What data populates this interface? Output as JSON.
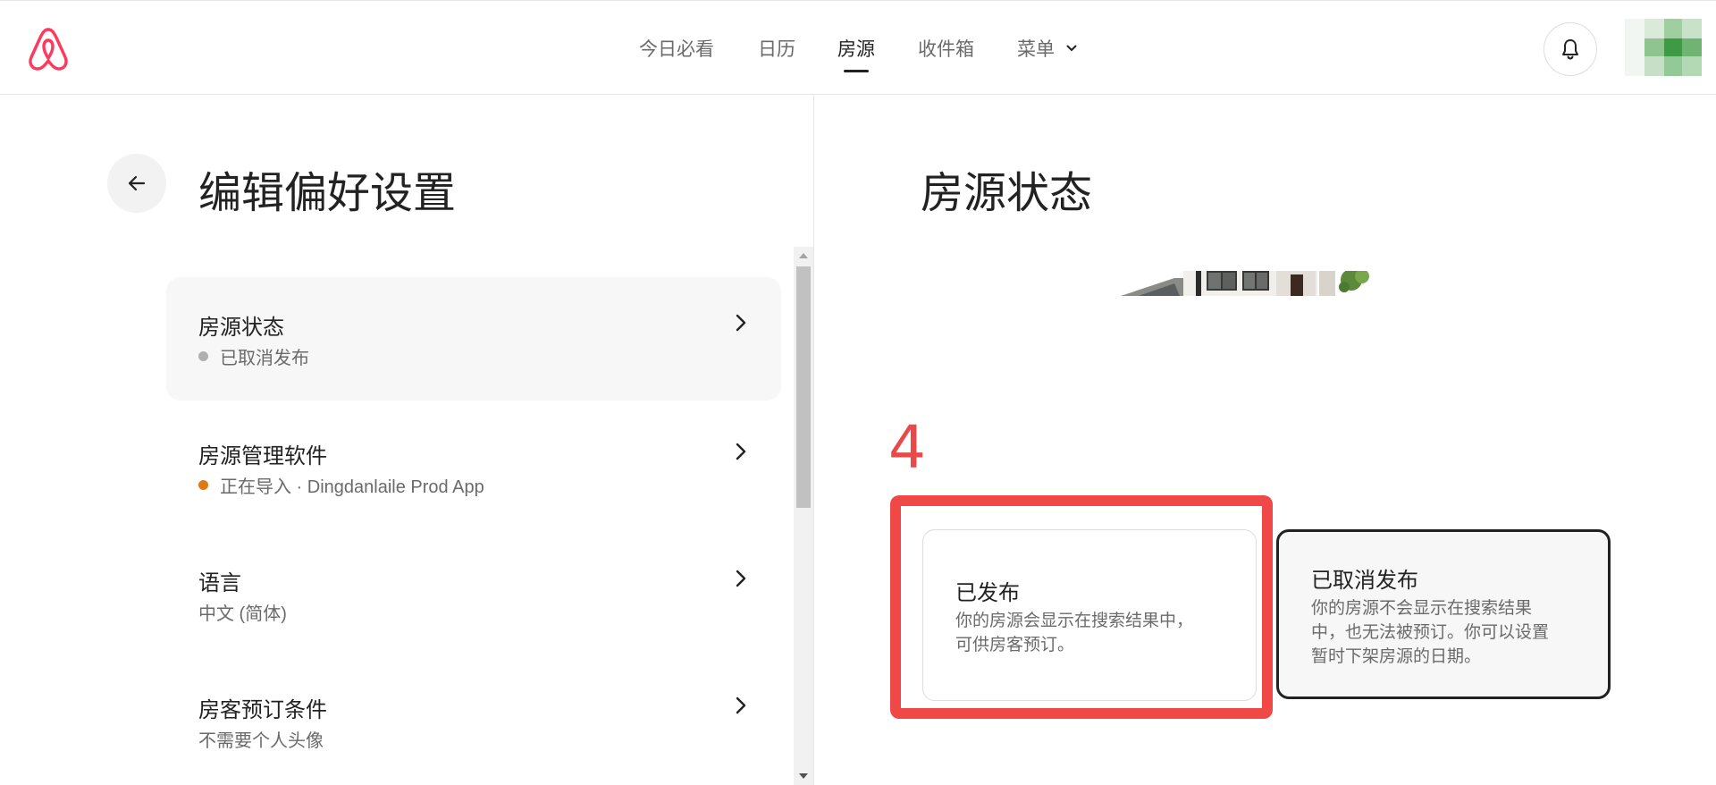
{
  "header": {
    "nav": [
      {
        "label": "今日必看"
      },
      {
        "label": "日历"
      },
      {
        "label": "房源"
      },
      {
        "label": "收件箱"
      },
      {
        "label": "菜单"
      }
    ],
    "active_nav": "房源",
    "logo_icon": "airbnb-logo-icon",
    "bell_icon": "bell-icon",
    "brand_color": "#ff385c"
  },
  "left": {
    "title": "编辑偏好设置",
    "items": [
      {
        "title": "房源状态",
        "subtitle": "已取消发布",
        "dot_color": "#b0b0b0"
      },
      {
        "title": "房源管理软件",
        "subtitle": "正在导入 · Dingdanlaile Prod App",
        "dot_color": "#e07912"
      },
      {
        "title": "语言",
        "subtitle": "中文 (简体)"
      },
      {
        "title": "房客预订条件",
        "subtitle": "不需要个人头像"
      }
    ]
  },
  "right": {
    "title": "房源状态",
    "annotation": "4",
    "annotation_color": "#f04747",
    "options": [
      {
        "title": "已发布",
        "desc_lines": [
          "你的房源会显示在搜索结果中，",
          "可供房客预订。"
        ]
      },
      {
        "title": "已取消发布",
        "desc_lines": [
          "你的房源不会显示在搜索结果",
          "中，也无法被预订。你可以设置",
          "暂时下架房源的日期。"
        ]
      }
    ]
  }
}
